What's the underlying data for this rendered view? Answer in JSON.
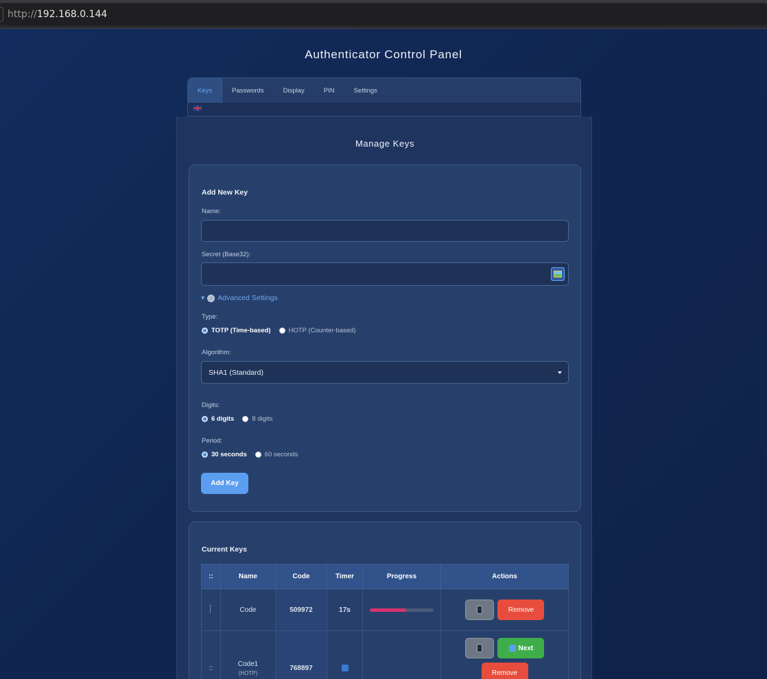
{
  "browser": {
    "url_scheme": "http://",
    "url_host": "192.168.0.144"
  },
  "app": {
    "title": "Authenticator Control Panel"
  },
  "tabs": [
    {
      "label": "Keys",
      "active": true
    },
    {
      "label": "Passwords",
      "active": false
    },
    {
      "label": "Display",
      "active": false
    },
    {
      "label": "PIN",
      "active": false
    },
    {
      "label": "Settings",
      "active": false
    }
  ],
  "language_flag": "uk-flag-icon",
  "section": {
    "title": "Manage Keys"
  },
  "add_key": {
    "heading": "Add New Key",
    "name_label": "Name:",
    "name_value": "",
    "secret_label": "Secret (Base32):",
    "secret_value": "",
    "advanced_label": "Advanced Settings",
    "type_label": "Type:",
    "type_options": [
      "TOTP (Time-based)",
      "HOTP (Counter-based)"
    ],
    "type_selected": "TOTP (Time-based)",
    "algorithm_label": "Algorithm:",
    "algorithm_value": "SHA1 (Standard)",
    "digits_label": "Digits:",
    "digits_options": [
      "6 digits",
      "8 digits"
    ],
    "digits_selected": "6 digits",
    "period_label": "Period:",
    "period_options": [
      "30 seconds",
      "60 seconds"
    ],
    "period_selected": "30 seconds",
    "submit_label": "Add Key"
  },
  "current_keys": {
    "heading": "Current Keys",
    "columns": [
      "::",
      "Name",
      "Code",
      "Timer",
      "Progress",
      "Actions"
    ],
    "rows": [
      {
        "name": "Code",
        "subtype": "",
        "code": "509972",
        "timer": "17s",
        "progress": 0.57,
        "next_label": "",
        "remove_label": "Remove"
      },
      {
        "name": "Code1",
        "subtype": "(HOTP)",
        "code": "768897",
        "timer": "",
        "progress": null,
        "next_label": "Next",
        "remove_label": "Remove"
      }
    ]
  },
  "colors": {
    "accent": "#5b9ef0",
    "danger": "#e74c3c",
    "success": "#3fae4a",
    "timer": "#4ee04e",
    "progress": "#d6336c"
  }
}
